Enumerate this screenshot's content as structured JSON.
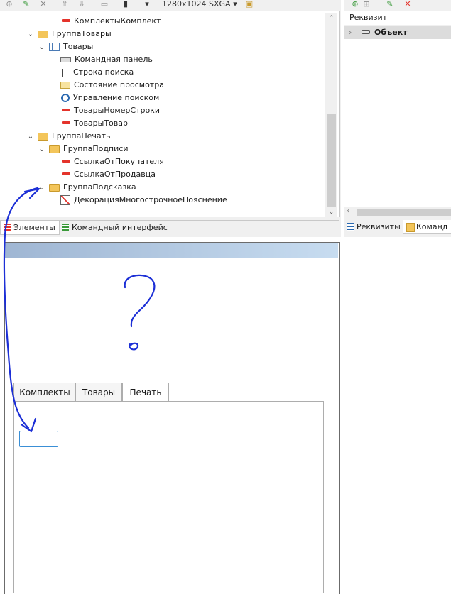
{
  "toolbar": {
    "resolution": "1280x1024 SXGA"
  },
  "tree": {
    "rows": [
      {
        "label": "КомплектыКомплект",
        "icon": "attribute-icon"
      },
      {
        "label": "ГруппаТовары",
        "icon": "folder-icon",
        "expanded": true
      },
      {
        "label": "Товары",
        "icon": "table-icon",
        "expanded": true
      },
      {
        "label": "Командная панель",
        "icon": "command-bar-icon"
      },
      {
        "label": "Строка поиска",
        "icon": "search-string-icon"
      },
      {
        "label": "Состояние просмотра",
        "icon": "view-status-icon"
      },
      {
        "label": "Управление поиском",
        "icon": "magnifier-icon"
      },
      {
        "label": "ТоварыНомерСтроки",
        "icon": "attribute-icon"
      },
      {
        "label": "ТоварыТовар",
        "icon": "attribute-icon"
      },
      {
        "label": "ГруппаПечать",
        "icon": "folder-icon",
        "expanded": true
      },
      {
        "label": "ГруппаПодписи",
        "icon": "folder-icon",
        "expanded": true
      },
      {
        "label": "СсылкаОтПокупателя",
        "icon": "attribute-icon"
      },
      {
        "label": "СсылкаОтПродавца",
        "icon": "attribute-icon"
      },
      {
        "label": "ГруппаПодсказка",
        "icon": "folder-icon",
        "expanded": true
      },
      {
        "label": "ДекорацияМногострочноеПояснение",
        "icon": "decoration-icon"
      }
    ]
  },
  "left_tabs": [
    {
      "label": "Элементы",
      "active": true
    },
    {
      "label": "Командный интерфейс",
      "active": false
    }
  ],
  "right_panel": {
    "header": "Реквизит",
    "row_label": "Объект"
  },
  "right_tabs": [
    {
      "label": "Реквизиты",
      "active": false
    },
    {
      "label": "Команд",
      "active": true
    }
  ],
  "form": {
    "tabs": [
      {
        "label": "Комплекты",
        "active": false
      },
      {
        "label": "Товары",
        "active": false
      },
      {
        "label": "Печать",
        "active": true
      }
    ]
  },
  "annotation": {
    "text": "?",
    "color": "#1c2fd6"
  }
}
